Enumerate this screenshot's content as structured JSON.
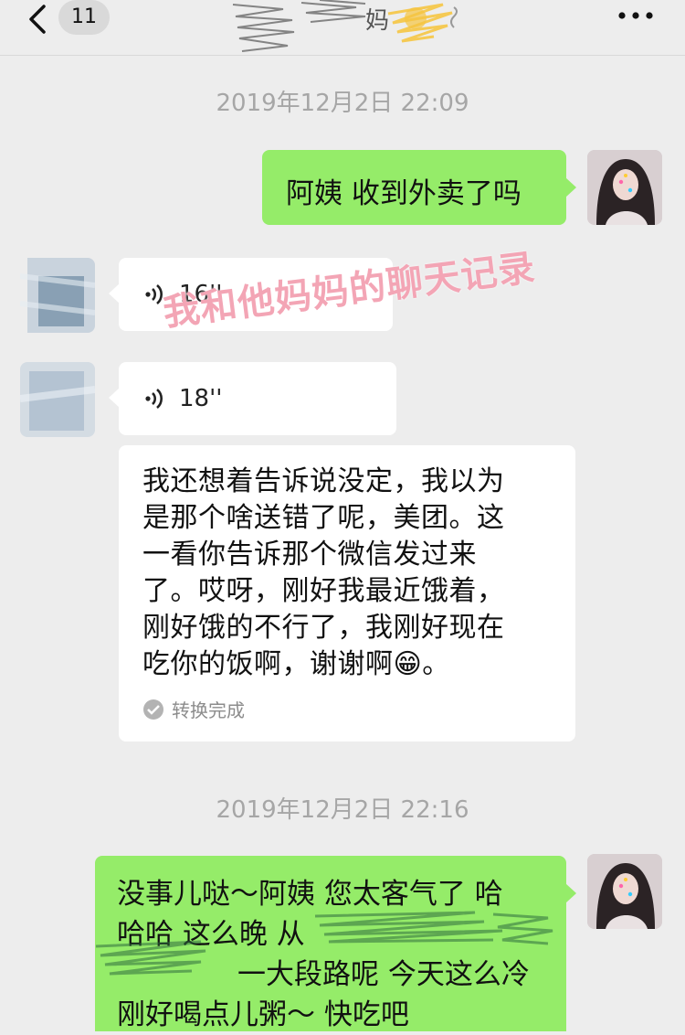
{
  "header": {
    "unread_count": "11",
    "title_suffix": "妈",
    "icons": [
      "back-chevron-icon",
      "more-dots-icon",
      "girl-emoji-icon"
    ]
  },
  "messages": [
    {
      "type": "timestamp",
      "text": "2019年12月2日 22:09"
    },
    {
      "type": "sent_text",
      "text": "阿姨 收到外卖了吗"
    },
    {
      "type": "received_voice",
      "duration": "16''"
    },
    {
      "type": "received_voice",
      "duration": "18''"
    },
    {
      "type": "received_transcript",
      "lines": [
        "我还想着告诉说没定，我以为",
        "是那个啥送错了呢，美团。这",
        "一看你告诉那个微信发过来",
        "了。哎呀，刚好我最近饿着，",
        "刚好饿的不行了，我刚好现在",
        "吃你的饭啊，谢谢啊😁。"
      ],
      "status": "转换完成"
    },
    {
      "type": "timestamp",
      "text": "2019年12月2日 22:16"
    },
    {
      "type": "sent_text",
      "lines": [
        "没事儿哒～阿姨 您太客气了 哈",
        "哈哈 这么晚 从",
        "一大段路呢 今天这么冷",
        "刚好喝点儿粥～ 快吃吧"
      ]
    }
  ],
  "overlay": {
    "watermark": "我和他妈妈的聊天记录"
  },
  "colors": {
    "sent_bubble": "#95ec69",
    "received_bubble": "#ffffff",
    "background": "#ededed",
    "watermark": "#f3a5b5"
  }
}
